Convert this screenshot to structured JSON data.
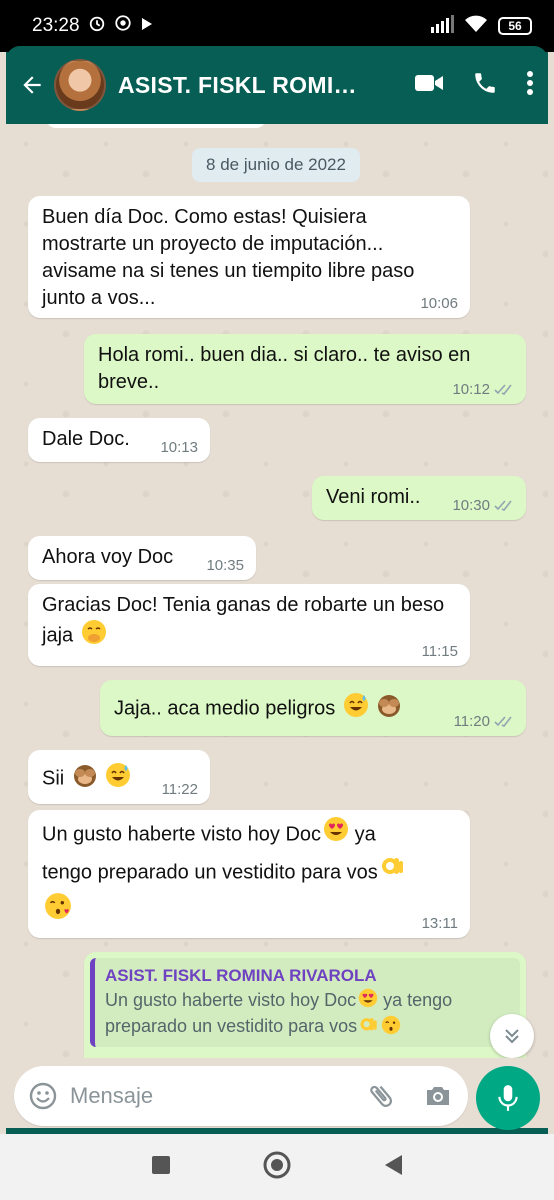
{
  "status_bar": {
    "time": "23:28",
    "battery": "56"
  },
  "header": {
    "contact_name": "ASIST. FISKL ROMINA RIVAROLA"
  },
  "chat": {
    "date_chip": "8 de junio de 2022",
    "messages": [
      {
        "dir": "in",
        "text": "Buen día Doc. Como estas! Quisiera mostrarte un proyecto de imputación... avisame na si tenes un tiempito libre paso junto a vos...",
        "time": "10:06"
      },
      {
        "dir": "out",
        "text": "Hola romi.. buen dia.. si claro.. te aviso en breve..",
        "time": "10:12",
        "ticks": "read"
      },
      {
        "dir": "in",
        "text": "Dale Doc.",
        "time": "10:13"
      },
      {
        "dir": "out",
        "text": "Veni romi..",
        "time": "10:30",
        "ticks": "read"
      },
      {
        "dir": "in",
        "text": "Ahora voy Doc",
        "time": "10:35"
      },
      {
        "dir": "in",
        "text": "Gracias Doc! Tenia ganas de robarte un beso jaja",
        "emoji": [
          "hand-over-mouth-emoji"
        ],
        "time": "11:15"
      },
      {
        "dir": "out",
        "text": "Jaja.. aca medio peligros",
        "emoji": [
          "sweat-smile-emoji",
          "see-no-evil-monkey-emoji"
        ],
        "time": "11:20",
        "ticks": "read"
      },
      {
        "dir": "in",
        "text": "Sii",
        "emoji": [
          "see-no-evil-monkey-emoji",
          "sweat-smile-emoji"
        ],
        "time": "11:22"
      },
      {
        "dir": "in",
        "text_line1": "Un gusto haberte visto hoy Doc",
        "text_line1b": " ya",
        "text_line2": "tengo preparado un vestidito para vos",
        "emoji": [
          "heart-eyes-emoji",
          "ok-hand-emoji",
          "kissing-heart-emoji"
        ],
        "time": "13:11"
      }
    ],
    "reply": {
      "author": "ASIST. FISKL ROMINA RIVAROLA",
      "quote_line1": "Un gusto haberte visto hoy Doc",
      "quote_line1b": " ya tengo",
      "quote_line2": "preparado un vestidito para vos"
    }
  },
  "composer": {
    "placeholder": "Mensaje"
  },
  "colors": {
    "header": "#075e54",
    "outgoing_bubble": "#dcf8c6",
    "incoming_bubble": "#ffffff",
    "read_ticks": "#8fa5b0",
    "mic_button": "#00a884",
    "quote_accent": "#6e42c1"
  }
}
